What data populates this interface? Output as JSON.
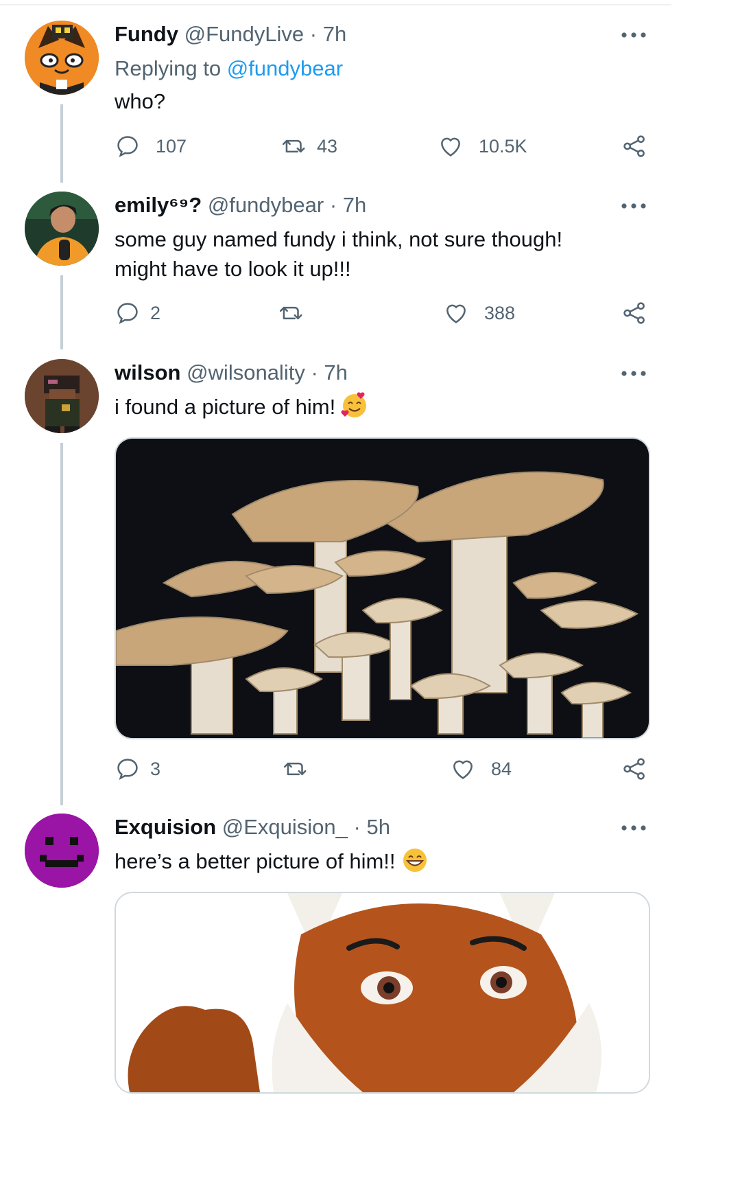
{
  "tweets": [
    {
      "name": "Fundy",
      "handle": "@FundyLive",
      "sep": "·",
      "time": "7h",
      "replying_prefix": "Replying to",
      "replying_to": "@fundybear",
      "text_lines": [
        "who?"
      ],
      "replies": "107",
      "retweets": "43",
      "likes": "10.5K"
    },
    {
      "name": "emily⁶⁹?",
      "handle": "@fundybear",
      "sep": "·",
      "time": "7h",
      "text_lines": [
        "some guy named fundy i think, not sure though!",
        "might have to look it up!!!"
      ],
      "replies": "2",
      "retweets": "",
      "likes": "388"
    },
    {
      "name": "wilson",
      "handle": "@wilsonality",
      "sep": "·",
      "time": "7h",
      "text_lines": [
        "i found a picture of him!"
      ],
      "emoji": "smiling-face-with-hearts-emoji",
      "image": "mushroom-cluster-photo",
      "replies": "3",
      "retweets": "",
      "likes": "84"
    },
    {
      "name": "Exquision",
      "handle": "@Exquision_",
      "sep": "·",
      "time": "5h",
      "text_lines": [
        "here’s a better picture of him!!"
      ],
      "emoji": "grinning-face-emoji",
      "image": "fox-mascot-photo"
    }
  ],
  "colors": {
    "link": "#1d9bf0",
    "secondary_text": "#536471",
    "thread_line": "#c4cfd6",
    "icon": "#536471"
  }
}
